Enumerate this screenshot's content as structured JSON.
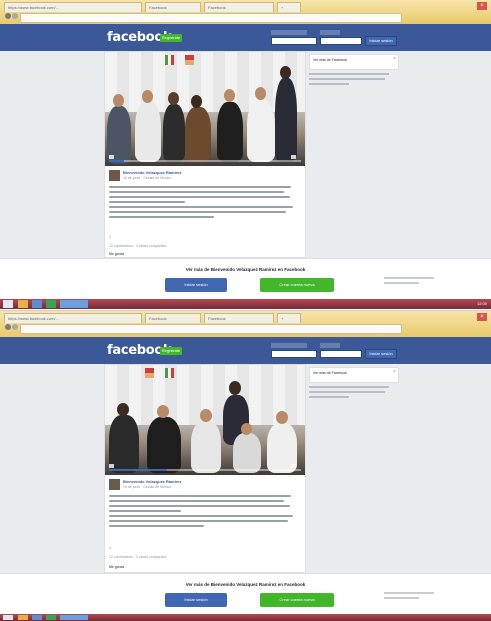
{
  "browser": {
    "tabs": [
      "https://www.facebook.com/...",
      "Facebook",
      "Facebook",
      "+"
    ],
    "close_label": "×"
  },
  "facebook": {
    "logo": "facebook",
    "register_badge": "Regístrate",
    "login_button": "Iniciar sesión"
  },
  "post": {
    "author": "Bienvenido Velazquez Ramirez",
    "meta": "10 de junio · Ciudad de México",
    "reactions": "3",
    "comments": "12 comentarios · 3 veces compartido",
    "like": "Me gusta"
  },
  "side": {
    "top_note": "Ver más de Facebook"
  },
  "prompt": {
    "text": "Ver más de Bienvenido Velazquez Ramirez en Facebook",
    "login_button": "Iniciar sesión",
    "create_button": "Crear cuenta nueva"
  },
  "taskbar": {
    "time": "12:00"
  },
  "colors": {
    "facebook_blue": "#3b5998",
    "button_blue": "#4267b2",
    "create_green": "#42b72a",
    "taskbar": "#7a2a3a"
  }
}
